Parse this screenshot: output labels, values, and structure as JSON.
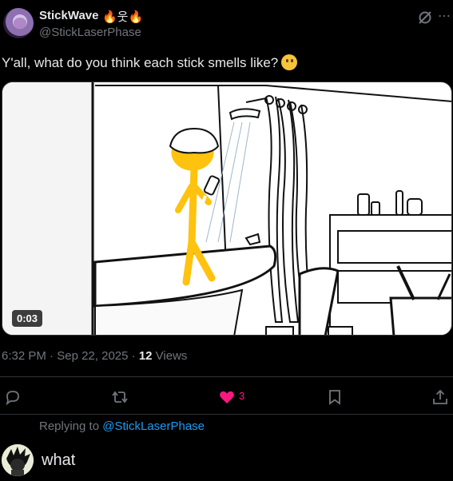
{
  "author": {
    "display_name": "StickWave",
    "display_name_emoji": "🔥웃🔥",
    "handle": "@StickLaserPhase"
  },
  "post": {
    "text": "Y'all, what do you think each stick smells like?",
    "video_duration": "0:03"
  },
  "meta": {
    "time": "6:32 PM",
    "separator": "·",
    "date": "Sep 22, 2025",
    "views_count": "12",
    "views_label": "Views"
  },
  "actions": {
    "like_count": "3"
  },
  "reply": {
    "replying_prefix": "Replying to",
    "replying_to": "@StickLaserPhase",
    "input_value": "what"
  },
  "colors": {
    "background": "#000000",
    "text_primary": "#e7e9ea",
    "text_secondary": "#71767b",
    "like_pink": "#f91880",
    "link_blue": "#1d9bf0",
    "stick_yellow": "#ffc20e"
  }
}
